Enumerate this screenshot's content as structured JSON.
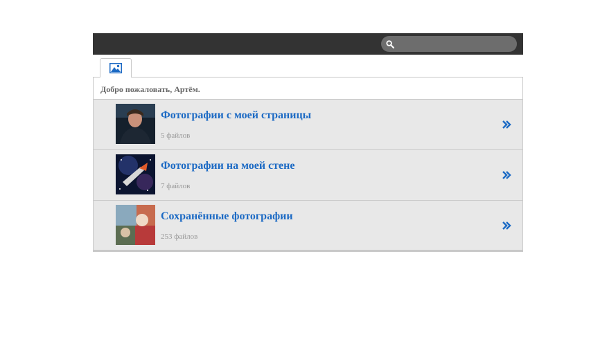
{
  "search": {
    "placeholder": "",
    "icon": "search-icon"
  },
  "tab": {
    "icon": "photos-icon",
    "color": "#1c6ac4"
  },
  "welcome": "Добро пожаловать, Артём.",
  "albums": [
    {
      "title": "Фотографии с моей страницы",
      "count": "5 файлов",
      "thumb": "portrait"
    },
    {
      "title": "Фотографии на моей стене",
      "count": "7 файлов",
      "thumb": "space"
    },
    {
      "title": "Сохранённые фотографии",
      "count": "253 файлов",
      "thumb": "collage"
    }
  ],
  "colors": {
    "accent": "#1c6ac4",
    "bar": "#333333",
    "row_bg": "#e8e8e8"
  }
}
